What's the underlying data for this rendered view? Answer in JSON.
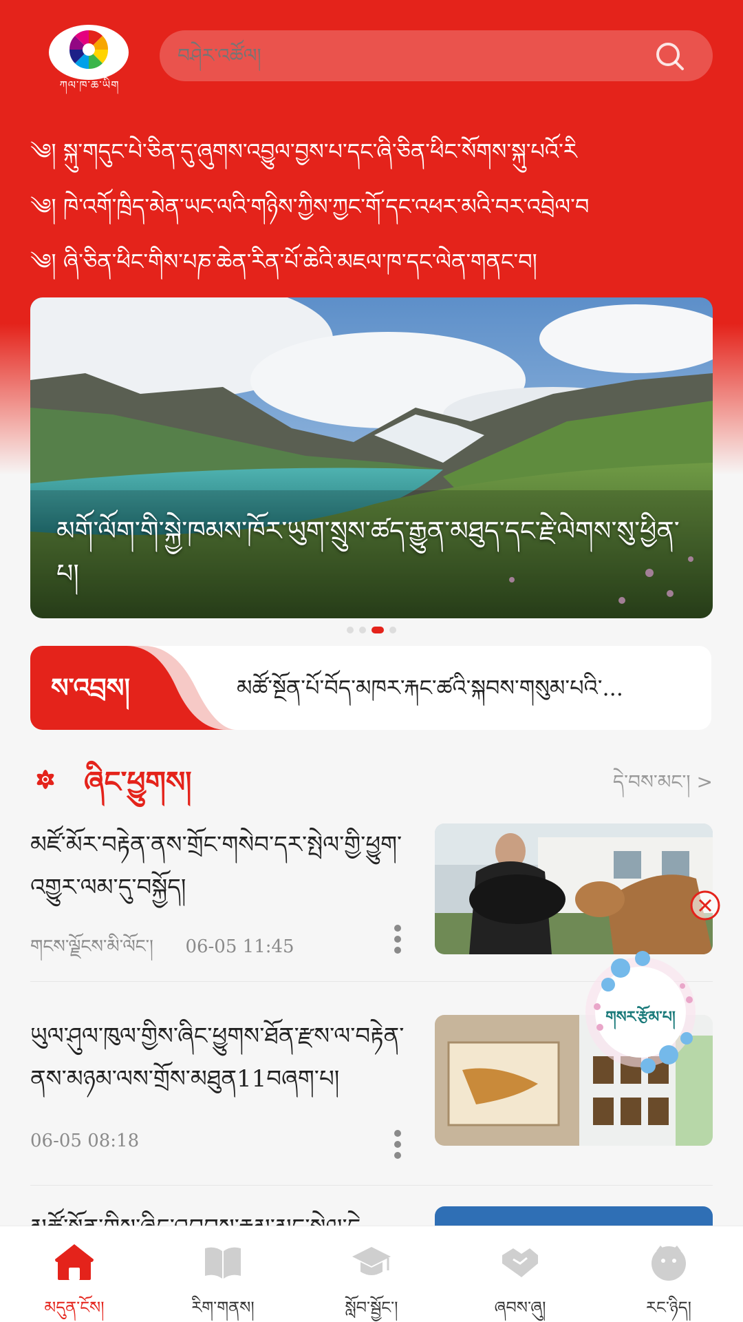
{
  "app": {
    "logo_text": "ཀལ་ཁ་ཆ་ཡིག",
    "search_placeholder": "བཤེར་འཚོལ།"
  },
  "announcements": [
    "༄། སྐུ་གདུང་པེ་ཅིན་དུ་ཞུགས་འབྱུལ་བྱས་པ་དང་ཞི་ཅིན་ཕིང་སོགས་སྐུ་པའོ་རི",
    "༄། ཁེ་འགོ་ཁྲིད་མེན་ཡང་ལའི་གཉིས་ཀྱིས་ཀྱང་གོ་དང་འཕར་མའི་བར་འབྲེལ་བ",
    "༄། ཞི་ཅིན་ཕིང་གིས་པཎ་ཆེན་རིན་པོ་ཆེའི་མཇལ་ཁ་དང་ལེན་གནང་བ།"
  ],
  "banner": {
    "caption": "མགོ་ལོག་གི་སྐྱེ་ཁམས་ཁོར་ཡུག་སྲུས་ཚད་རྒྱུན་མཐུད་དང་རྗེ་ལེགས་སུ་ཕྱིན་པ།",
    "slide_count": 4,
    "active_index": 2
  },
  "notice": {
    "tag": "ས་འབྲས།",
    "text": "མཚོ་སྔོན་པོ་བོད་མཁར་རྐང་ཚའི་སྐབས་གསུམ་པའི་..."
  },
  "section": {
    "title": "ཞིང་ཕྱུགས།",
    "more": "དེ་བས་མང་། >"
  },
  "news": [
    {
      "title": "མཛོ་མོར་བརྟེན་ནས་གྲོང་གསེབ་དར་སྤེལ་གྱི་ཕྱུག་འགྱུར་ལམ་དུ་བསྐྱོད།",
      "source": "གངས་ལྗོངས་མི་ལོང་།",
      "time": "06-05 11:45",
      "thumb": "woman-with-yak"
    },
    {
      "title": "ཡུལ་ཤུལ་ཁུལ་གྱིས་ཞིང་ཕྱུགས་ཐོན་རྫས་ལ་བརྟེན་ནས་མཉམ་ལས་གྲོས་མཐུན11བཞག་པ།",
      "source": "",
      "time": "06-05 08:18",
      "thumb": "products-display"
    },
    {
      "title": "མཚོ་སྔོན་གྱིས་ཞིང་འབབས་རྣམ་མང་སྤེལ་དེ",
      "source": "",
      "time": "",
      "thumb": "blue"
    }
  ],
  "float": {
    "label": "གསར་རྩོམ་པ།"
  },
  "nav": [
    {
      "label": "མདུན་ངོས།",
      "icon": "home-icon",
      "active": true
    },
    {
      "label": "རིག་གནས།",
      "icon": "book-icon",
      "active": false
    },
    {
      "label": "སློབ་སྦྱོང་།",
      "icon": "graduation-cap-icon",
      "active": false
    },
    {
      "label": "ཞབས་ཞུ།",
      "icon": "handshake-icon",
      "active": false
    },
    {
      "label": "རང་ཉིད།",
      "icon": "user-face-icon",
      "active": false
    }
  ],
  "colors": {
    "brand_red": "#e4231b",
    "nav_inactive": "#cfcfcf"
  }
}
